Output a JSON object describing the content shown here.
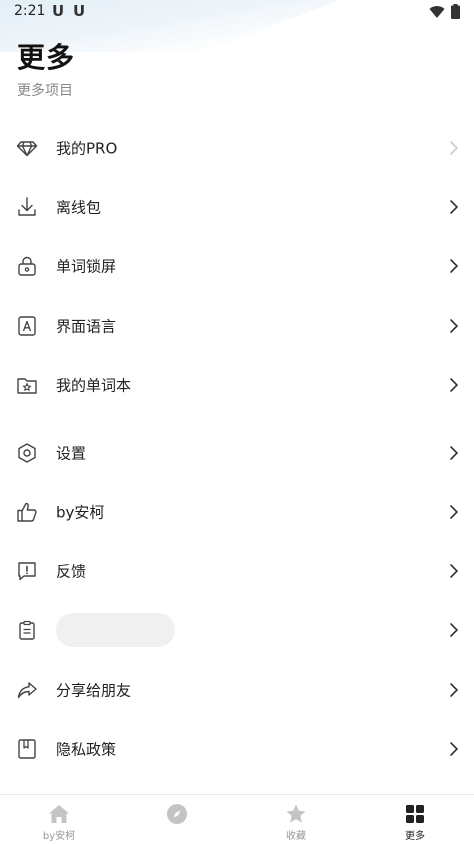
{
  "status_bar": {
    "time": "2:21",
    "notifications": [
      "U",
      "U"
    ]
  },
  "header": {
    "title": "更多",
    "subtitle": "更多项目"
  },
  "menu": [
    {
      "label": "我的PRO",
      "icon": "diamond-icon"
    },
    {
      "label": "离线包",
      "icon": "download-icon"
    },
    {
      "label": "单词锁屏",
      "icon": "lock-icon"
    },
    {
      "label": "界面语言",
      "icon": "language-icon"
    },
    {
      "label": "我的单词本",
      "icon": "folder-star-icon"
    },
    {
      "label": "设置",
      "icon": "settings-icon"
    },
    {
      "label": "by安柯",
      "icon": "thumbs-up-icon"
    },
    {
      "label": "反馈",
      "icon": "feedback-icon"
    },
    {
      "label": "",
      "icon": "clipboard-icon"
    },
    {
      "label": "分享给朋友",
      "icon": "share-icon"
    },
    {
      "label": "隐私政策",
      "icon": "bookmark-icon"
    }
  ],
  "bottom_nav": {
    "tabs": [
      {
        "label": "by安柯",
        "icon": "home-icon"
      },
      {
        "label": "",
        "icon": "compass-icon"
      },
      {
        "label": "收藏",
        "icon": "star-icon"
      },
      {
        "label": "更多",
        "icon": "grid-icon"
      }
    ],
    "active": "更多"
  },
  "colors": {
    "accent": "#222222",
    "inactive": "#999999",
    "chevron": "#333333",
    "chevron_disabled": "#cccccc"
  }
}
